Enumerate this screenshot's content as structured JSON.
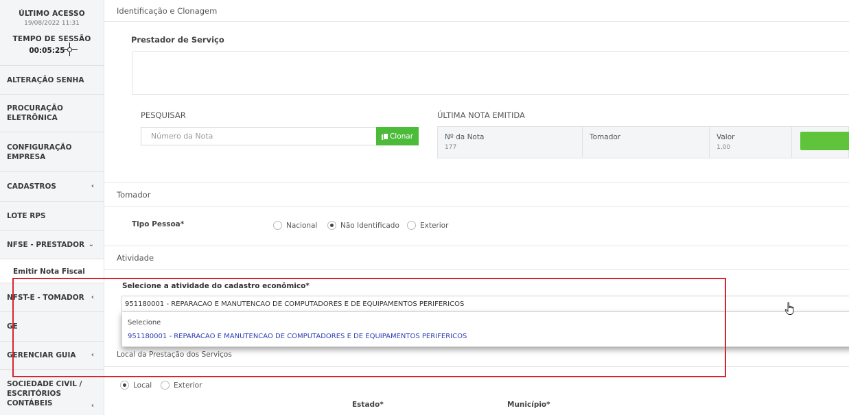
{
  "sidebar": {
    "ultimo_acesso_label": "ÚLTIMO ACESSO",
    "ultimo_acesso_value": "19/08/2022 11:31",
    "tempo_sessao_label": "TEMPO DE SESSÃO",
    "tempo_sessao_value": "00:05:25",
    "items": [
      {
        "label": "ALTERAÇÃO SENHA"
      },
      {
        "label": "PROCURAÇÃO ELETRÔNICA"
      },
      {
        "label": "CONFIGURAÇÃO EMPRESA"
      },
      {
        "label": "CADASTROS",
        "chevron": "‹"
      },
      {
        "label": "LOTE RPS"
      },
      {
        "label": "NFSE - PRESTADOR",
        "chevron": "⌄"
      },
      {
        "label": "Emitir Nota Fiscal"
      },
      {
        "label": "NFST-E - TOMADOR",
        "chevron": "‹"
      },
      {
        "label": "GE"
      },
      {
        "label": "GERENCIAR GUIA",
        "chevron": "‹"
      },
      {
        "label": "SOCIEDADE CIVIL / ESCRITÓRIOS CONTÁBEIS",
        "chevron": "‹"
      }
    ]
  },
  "main": {
    "identificacao_title": "Identificação e Clonagem",
    "prestador_title": "Prestador de Serviço",
    "pesquisar_label": "PESQUISAR",
    "search_placeholder": "Número da Nota",
    "clone_label": "Clonar",
    "ultima_nota_label": "ÚLTIMA NOTA EMITIDA",
    "nota_table": {
      "nota_header": "Nº da Nota",
      "nota_value": "177",
      "tomador_header": "Tomador",
      "tomador_value": "",
      "valor_header": "Valor",
      "valor_value": "1,00"
    },
    "tomador_title": "Tomador",
    "tipo_pessoa_label": "Tipo Pessoa*",
    "tipo_pessoa_options": [
      "Nacional",
      "Não Identificado",
      "Exterior"
    ],
    "tipo_pessoa_selected": "Não Identificado",
    "atividade_title": "Atividade",
    "atividade_label": "Selecione a atividade do cadastro econômico*",
    "atividade_value": "951180001 - REPARACAO E MANUTENCAO DE COMPUTADORES E DE EQUIPAMENTOS PERIFERICOS",
    "dropdown_options": [
      "Selecione",
      "951180001 - REPARACAO E MANUTENCAO DE COMPUTADORES E DE EQUIPAMENTOS PERIFERICOS"
    ],
    "local_prestacao_title": "Local da Prestação dos Serviços",
    "local_options": [
      "Local",
      "Exterior"
    ],
    "local_selected": "Local",
    "estado_label": "Estado*",
    "municipio_label": "Município*"
  },
  "colors": {
    "accent_green": "#4cbb3a",
    "highlight_red": "#d9262e",
    "link_blue": "#2b3fb5"
  }
}
